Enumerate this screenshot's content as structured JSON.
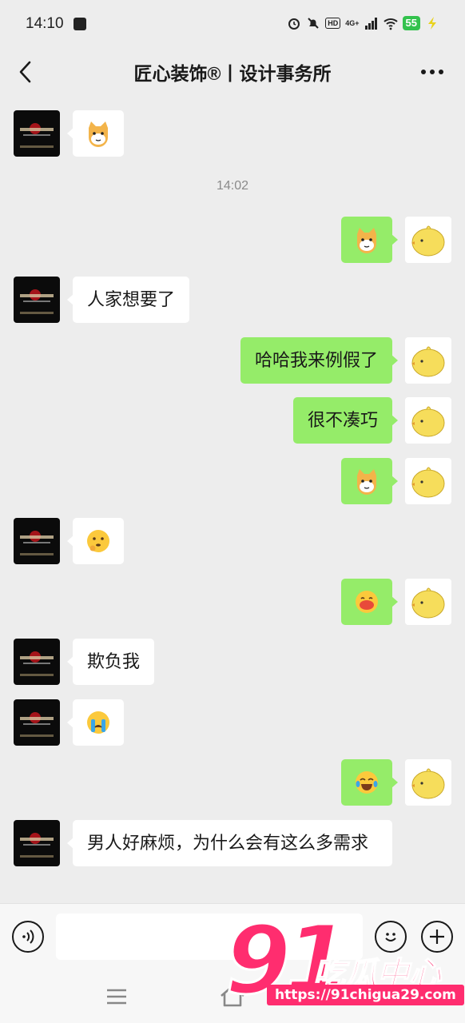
{
  "status_bar": {
    "time": "14:10",
    "network": "4G+",
    "hd": "HD",
    "battery": "55"
  },
  "header": {
    "title": "匠心装饰®丨设计事务所"
  },
  "timestamp": "14:02",
  "messages": [
    {
      "side": "in",
      "type": "emoji",
      "emoji": "doge-cat"
    },
    {
      "side": "out",
      "type": "emoji",
      "emoji": "doge-cat"
    },
    {
      "side": "in",
      "type": "text",
      "text": "人家想要了"
    },
    {
      "side": "out",
      "type": "text",
      "text": "哈哈我来例假了"
    },
    {
      "side": "out",
      "type": "text",
      "text": "很不凑巧"
    },
    {
      "side": "out",
      "type": "emoji",
      "emoji": "doge-cat"
    },
    {
      "side": "in",
      "type": "emoji",
      "emoji": "thinking-face"
    },
    {
      "side": "out",
      "type": "emoji",
      "emoji": "blushing-face"
    },
    {
      "side": "in",
      "type": "text",
      "text": "欺负我"
    },
    {
      "side": "in",
      "type": "emoji",
      "emoji": "crying-face"
    },
    {
      "side": "out",
      "type": "emoji",
      "emoji": "tears-of-joy-face"
    },
    {
      "side": "in",
      "type": "text",
      "text": "男人好麻烦，为什么会有这么多需求"
    }
  ],
  "input": {
    "placeholder": ""
  },
  "watermark": {
    "number": "91",
    "name": "吃瓜中心",
    "url": "https://91chigua29.com"
  },
  "colors": {
    "outgoing_bubble": "#95ec69",
    "incoming_bubble": "#ffffff",
    "background": "#ededed",
    "watermark": "#ff2d6f"
  }
}
